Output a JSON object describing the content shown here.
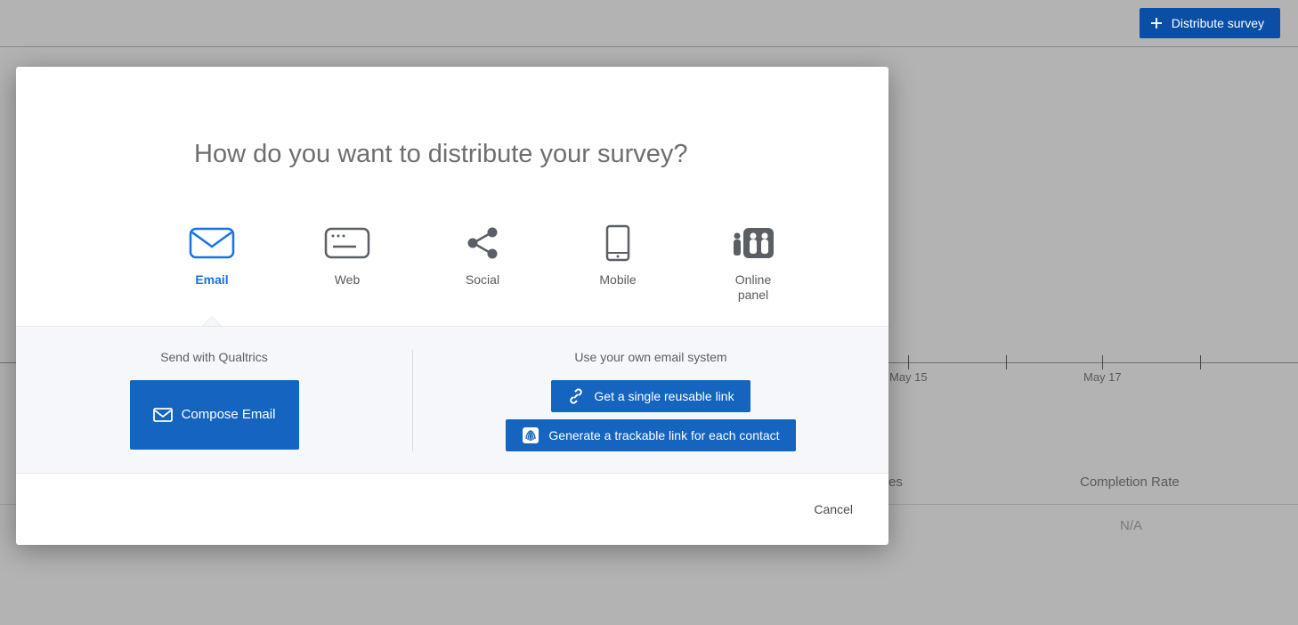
{
  "header": {
    "distribute_button": "Distribute survey"
  },
  "background": {
    "tick_labels": [
      "May 15",
      "May 17"
    ],
    "stat_label_1_suffix": "es",
    "completion_rate_label": "Completion Rate",
    "completion_rate_value": "N/A"
  },
  "modal": {
    "title": "How do you want to distribute your survey?",
    "tabs": [
      {
        "label": "Email"
      },
      {
        "label": "Web"
      },
      {
        "label": "Social"
      },
      {
        "label": "Mobile"
      },
      {
        "label": "Online panel"
      }
    ],
    "left": {
      "heading": "Send with Qualtrics",
      "compose_button": "Compose Email"
    },
    "right": {
      "heading": "Use your own email system",
      "single_link_button": "Get a single reusable link",
      "trackable_link_button": "Generate a trackable link for each contact"
    },
    "cancel": "Cancel"
  }
}
